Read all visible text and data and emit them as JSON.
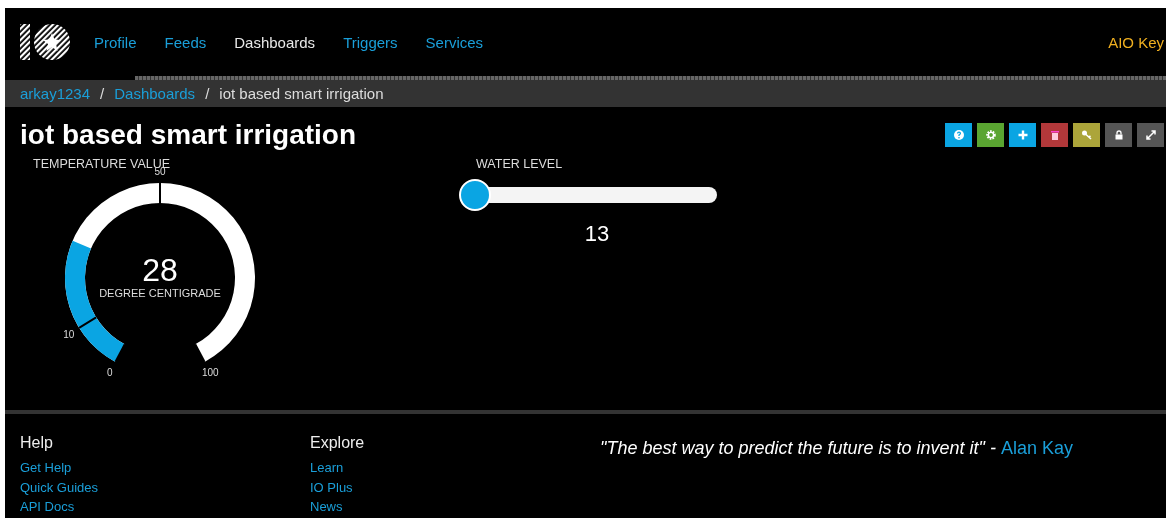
{
  "nav": {
    "items": [
      {
        "label": "Profile",
        "selected": false
      },
      {
        "label": "Feeds",
        "selected": false
      },
      {
        "label": "Dashboards",
        "selected": true
      },
      {
        "label": "Triggers",
        "selected": false
      },
      {
        "label": "Services",
        "selected": false
      }
    ],
    "key_link": "AIO Key"
  },
  "breadcrumb": [
    {
      "label": "arkay1234",
      "kind": "link"
    },
    {
      "label": "Dashboards",
      "kind": "link"
    },
    {
      "label": "iot based smart irrigation",
      "kind": "current"
    }
  ],
  "breadcrumb_separator": "/",
  "title": "iot based smart irrigation",
  "toolbar": [
    {
      "kind": "help",
      "color": "#0aa5e3"
    },
    {
      "kind": "settings",
      "color": "#5aa531"
    },
    {
      "kind": "add",
      "color": "#0aa5e3"
    },
    {
      "kind": "delete",
      "color": "#b2383a"
    },
    {
      "kind": "key",
      "color": "#aca53a"
    },
    {
      "kind": "lock",
      "color": "#555555"
    },
    {
      "kind": "expand",
      "color": "#555555"
    }
  ],
  "gauge": {
    "title": "TEMPERATURE VALUE",
    "value": "28",
    "unit": "DEGREE CENTIGRADE",
    "level": 0.28,
    "ticks": [
      "0",
      "10",
      "50",
      "100"
    ]
  },
  "slider": {
    "title": "WATER LEVEL",
    "level": 0,
    "value": "13"
  },
  "footer": {
    "columns": [
      {
        "heading": "Help",
        "links": [
          "Get Help",
          "Quick Guides",
          "API Docs"
        ]
      },
      {
        "heading": "Explore",
        "links": [
          "Learn",
          "IO Plus",
          "News"
        ]
      }
    ],
    "quote": "\"The best way to predict the future is to invent it\" -",
    "author": "Alan Kay"
  }
}
